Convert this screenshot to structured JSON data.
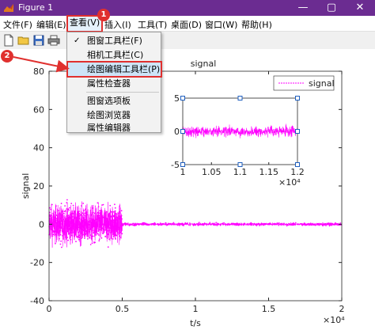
{
  "window": {
    "title": "Figure 1",
    "minimize": "—",
    "maximize": "▢",
    "close": "✕"
  },
  "menu": [
    {
      "label": "文件(F)"
    },
    {
      "label": "编辑(E)"
    },
    {
      "label": "查看(V)"
    },
    {
      "label": "插入(I)"
    },
    {
      "label": "工具(T)"
    },
    {
      "label": "桌面(D)"
    },
    {
      "label": "窗口(W)"
    },
    {
      "label": "帮助(H)"
    }
  ],
  "toolbar": [
    "new-file-icon",
    "open-folder-icon",
    "save-icon",
    "print-icon"
  ],
  "dropdown": {
    "check": "✓",
    "items": [
      {
        "label": "图窗工具栏(F)",
        "checked": true
      },
      {
        "label": "相机工具栏(C)"
      },
      {
        "label": "绘图编辑工具栏(P)",
        "highlighted": true
      },
      {
        "label": "属性检查器"
      },
      {
        "label": "图窗选项板"
      },
      {
        "label": "绘图浏览器"
      },
      {
        "label": "属性编辑器"
      }
    ]
  },
  "badges": {
    "one": "1",
    "two": "2"
  },
  "chart_data": [
    {
      "type": "scatter",
      "title": "signal",
      "xlabel": "t/s",
      "ylabel": "signal",
      "xlim": [
        0,
        20000
      ],
      "ylim": [
        -40,
        80
      ],
      "xticks": [
        "0",
        "0.5",
        "1",
        "1.5",
        "2"
      ],
      "yticks": [
        "-40",
        "-20",
        "0",
        "20",
        "40",
        "60",
        "80"
      ],
      "x_exponent": "×10⁴",
      "legend": {
        "label": "signal",
        "placement": "top-right"
      },
      "color": "#ff00ff",
      "series": [
        {
          "segment": "noisy",
          "x_range": [
            0,
            5000
          ],
          "y_range": [
            -30,
            35
          ]
        },
        {
          "segment": "quiet",
          "x_range": [
            5000,
            20000
          ],
          "y_range": [
            -3,
            3
          ]
        }
      ]
    },
    {
      "type": "scatter",
      "title": "",
      "xlim": [
        10000,
        12000
      ],
      "ylim": [
        -5,
        5
      ],
      "xticks": [
        "1",
        "1.05",
        "1.1",
        "1.15",
        "1.2"
      ],
      "yticks": [
        "-5",
        "0",
        "5"
      ],
      "x_exponent": "×10⁴",
      "color": "#ff00ff",
      "series": [
        {
          "x_range": [
            10000,
            12000
          ],
          "y_range": [
            -2.5,
            2.5
          ]
        }
      ]
    }
  ]
}
